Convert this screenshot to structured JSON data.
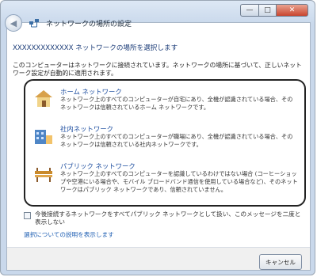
{
  "window": {
    "title": "ネットワークの場所の設定",
    "caption_buttons": {
      "minimize": "—",
      "maximize": "□",
      "close": "✕"
    }
  },
  "heading": "XXXXXXXXXXXXX ネットワークの場所を選択します",
  "intro": "このコンピューターはネットワークに接続されています。ネットワークの場所に基づいて、正しいネットワーク設定が自動的に適用されます。",
  "options": [
    {
      "title": "ホーム ネットワーク",
      "desc": "ネットワーク上のすべてのコンピューターが自宅にあり、全機が認識されている場合、そのネットワークは信頼されているホーム ネットワークです。",
      "icon": "home-network-icon"
    },
    {
      "title": "社内ネットワーク",
      "desc": "ネットワーク上のすべてのコンピューターが職場にあり、全機が認識されている場合、そのネットワークは信頼されている社内ネットワークです。",
      "icon": "work-network-icon"
    },
    {
      "title": "パブリック ネットワーク",
      "desc": "ネットワーク上のすべてのコンピューターを認識しているわけではない場合 (コーヒーショップや空港にいる場合や、モバイル ブロードバンド通信を使用している場合など)、そのネットワークはパブリック ネットワークであり、信頼されていません。",
      "icon": "public-network-icon"
    }
  ],
  "checkbox_label": "今後接続するネットワークをすべてパブリック ネットワークとして扱い、このメッセージを二度と表示しない",
  "link_text": "選択についての説明を表示します",
  "cancel_label": "キャンセル",
  "colors": {
    "link": "#1f5fb3",
    "heading": "#1f3f7a",
    "selected_outline": "#222222"
  }
}
